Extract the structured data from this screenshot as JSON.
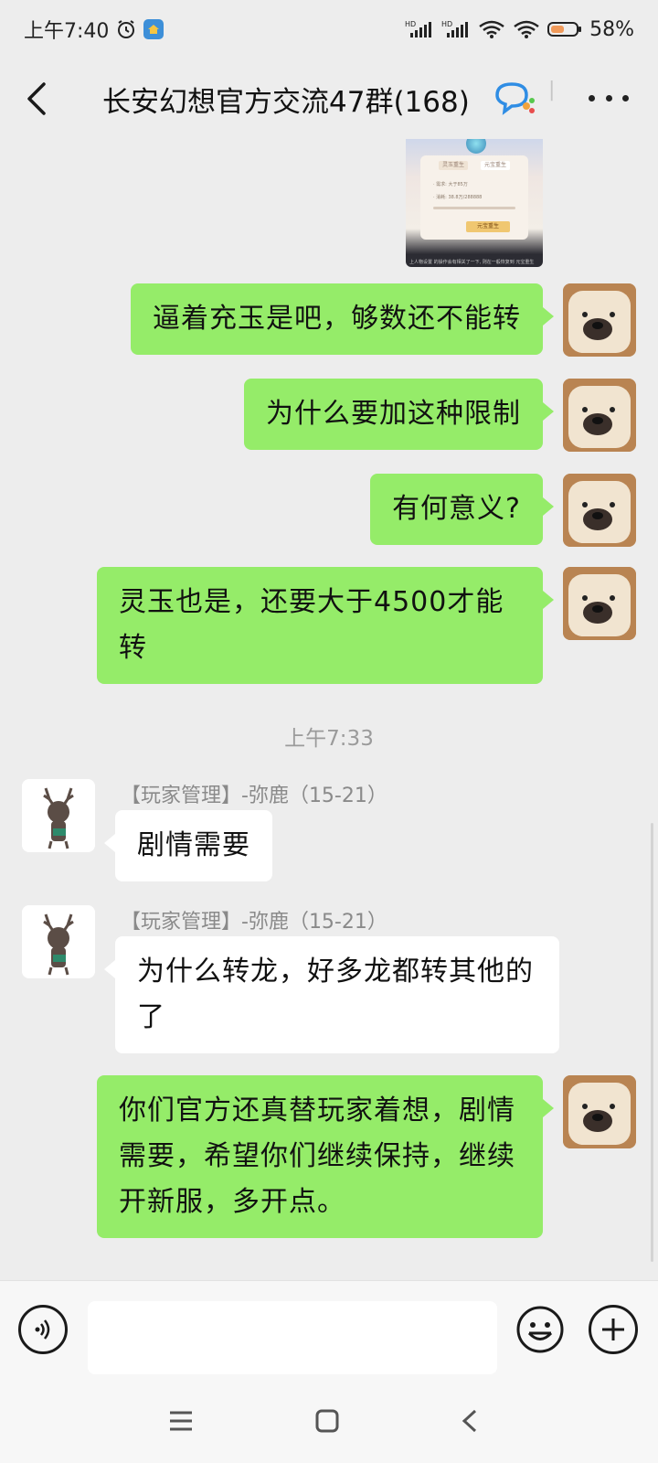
{
  "status_bar": {
    "time": "上午7:40",
    "battery": "58%",
    "hd1": "HD",
    "hd2": "HD"
  },
  "header": {
    "title": "长安幻想官方交流47群(168)"
  },
  "image_message": {
    "tab1": "灵玉重生",
    "tab2": "元宝重生",
    "button": "元宝重生",
    "line1": "· 需求: 大于85万",
    "line2": "· 消耗: 38.8万/288888",
    "footer": "上人物设置 的操作会有相关了一下, 则在一般恢复到 元宝重生"
  },
  "messages": [
    {
      "side": "me",
      "text": "逼着充玉是吧，够数还不能转"
    },
    {
      "side": "me",
      "text": "为什么要加这种限制"
    },
    {
      "side": "me",
      "text": "有何意义?"
    },
    {
      "side": "me",
      "text": "灵玉也是，还要大于4500才能转"
    },
    {
      "side": "other",
      "sender": "【玩家管理】-弥鹿（15-21）",
      "text": "剧情需要"
    },
    {
      "side": "other",
      "sender": "【玩家管理】-弥鹿（15-21）",
      "text": "为什么转龙，好多龙都转其他的了"
    },
    {
      "side": "me",
      "text": "你们官方还真替玩家着想，剧情需要，希望你们继续保持，继续开新服，多开点。"
    }
  ],
  "timestamp": "上午7:33",
  "input": {
    "value": "",
    "placeholder": ""
  },
  "colors": {
    "my_bubble": "#95ec69",
    "other_bubble": "#ffffff",
    "background": "#ededed"
  },
  "icons": [
    "back-icon",
    "group-chat-icon",
    "more-icon",
    "voice-icon",
    "emoji-icon",
    "plus-icon",
    "menu-icon",
    "home-icon",
    "nav-back-icon"
  ]
}
